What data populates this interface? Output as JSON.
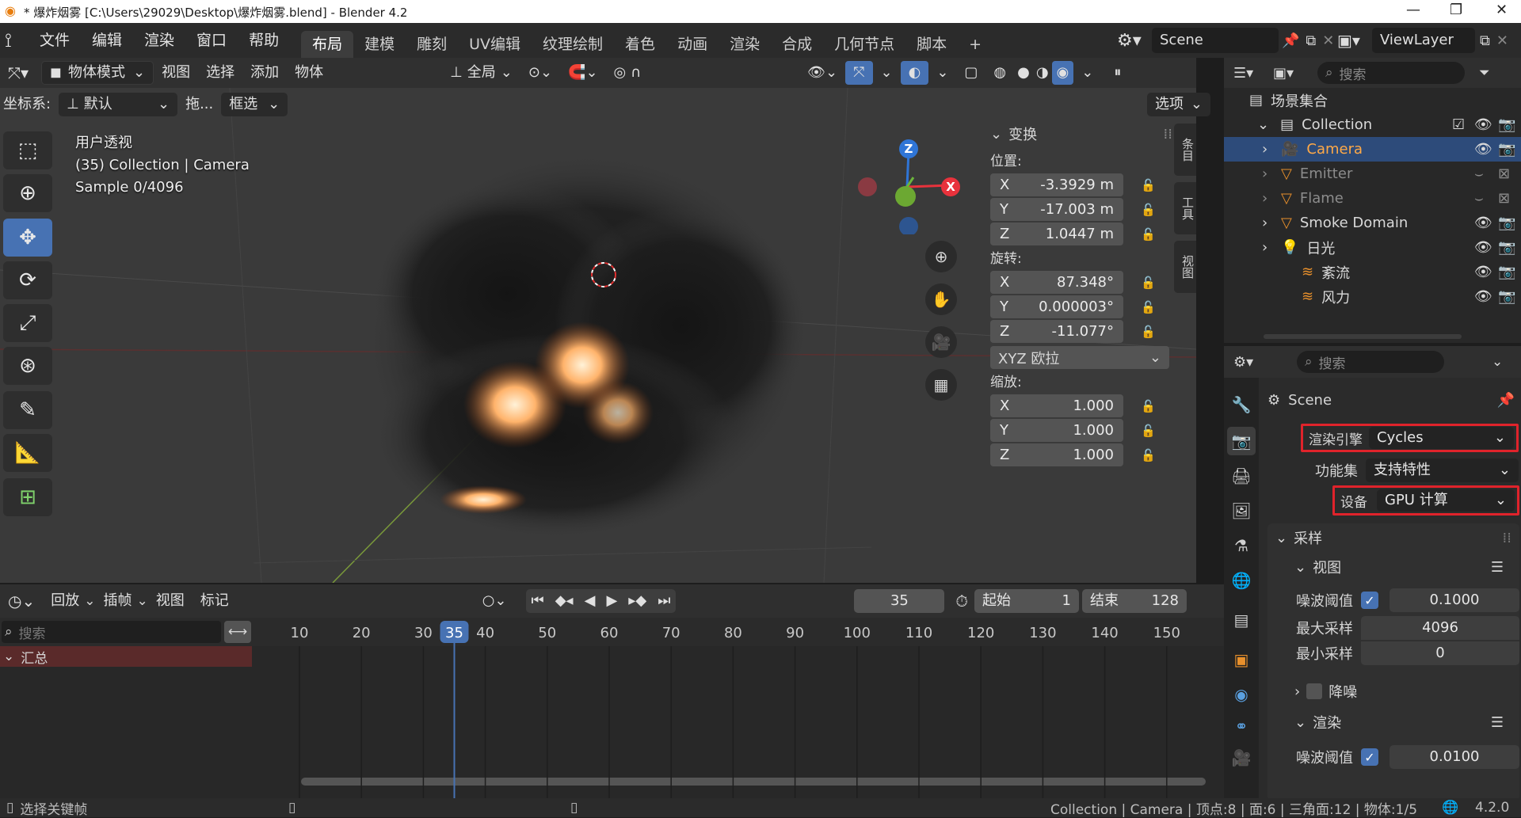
{
  "window": {
    "title": "* 爆炸烟雾 [C:\\Users\\29029\\Desktop\\爆炸烟雾.blend] - Blender 4.2",
    "controls": [
      "—",
      "❐",
      "✕"
    ]
  },
  "menu": [
    "文件",
    "编辑",
    "渲染",
    "窗口",
    "帮助"
  ],
  "workspaces": [
    "布局",
    "建模",
    "雕刻",
    "UV编辑",
    "纹理绘制",
    "着色",
    "动画",
    "渲染",
    "合成",
    "几何节点",
    "脚本",
    "+"
  ],
  "scene": {
    "name": "Scene"
  },
  "viewlayer": {
    "name": "ViewLayer"
  },
  "viewport_header": {
    "mode": "物体模式",
    "menus": [
      "视图",
      "选择",
      "添加",
      "物体"
    ],
    "transform_orientation": "全局"
  },
  "viewport_header2": {
    "coord_label": "坐标系:",
    "coord_value": "默认",
    "drag_label": "拖...",
    "select_mode": "框选",
    "options": "选项"
  },
  "viewport_overlay": {
    "view_name": "用户透视",
    "collection_line": "(35) Collection | Camera",
    "sample_line": "Sample 0/4096"
  },
  "gizmo": {
    "z": "Z",
    "x": "X"
  },
  "npanel": {
    "section": "变换",
    "location_label": "位置:",
    "location": [
      {
        "axis": "X",
        "value": "-3.3929 m"
      },
      {
        "axis": "Y",
        "value": "-17.003 m"
      },
      {
        "axis": "Z",
        "value": "1.0447 m"
      }
    ],
    "rotation_label": "旋转:",
    "rotation": [
      {
        "axis": "X",
        "value": "87.348°"
      },
      {
        "axis": "Y",
        "value": "0.000003°"
      },
      {
        "axis": "Z",
        "value": "-11.077°"
      }
    ],
    "rotation_mode": "XYZ 欧拉",
    "scale_label": "缩放:",
    "scale": [
      {
        "axis": "X",
        "value": "1.000"
      },
      {
        "axis": "Y",
        "value": "1.000"
      },
      {
        "axis": "Z",
        "value": "1.000"
      }
    ],
    "side_tabs": [
      "条目",
      "工具",
      "视图"
    ]
  },
  "outliner": {
    "search_placeholder": "搜索",
    "root": "场景集合",
    "collection": "Collection",
    "items": [
      {
        "name": "Camera",
        "selected": true
      },
      {
        "name": "Emitter",
        "dim": true
      },
      {
        "name": "Flame",
        "dim": true
      },
      {
        "name": "Smoke Domain"
      },
      {
        "name": "日光"
      },
      {
        "name": "紊流"
      },
      {
        "name": "风力"
      }
    ]
  },
  "properties": {
    "search_placeholder": "搜索",
    "scene": "Scene",
    "render_engine_label": "渲染引擎",
    "render_engine": "Cycles",
    "feature_set_label": "功能集",
    "feature_set": "支持特性",
    "device_label": "设备",
    "device": "GPU 计算",
    "sampling": "采样",
    "viewport": "视图",
    "noise_threshold_label": "噪波阈值",
    "noise_threshold_view": "0.1000",
    "max_samples_label": "最大采样",
    "max_samples": "4096",
    "min_samples_label": "最小采样",
    "min_samples": "0",
    "denoise": "降噪",
    "render": "渲染",
    "noise_threshold_render": "0.0100"
  },
  "timeline": {
    "menus": [
      "回放",
      "插帧",
      "视图",
      "标记"
    ],
    "current_frame": "35",
    "start_label": "起始",
    "start": "1",
    "end_label": "结束",
    "end": "128",
    "search_placeholder": "搜索",
    "summary": "汇总",
    "ticks": [
      "10",
      "20",
      "30",
      "35",
      "40",
      "50",
      "60",
      "70",
      "80",
      "90",
      "100",
      "110",
      "120",
      "130",
      "140",
      "150"
    ]
  },
  "statusbar": {
    "left": "选择关键帧",
    "right": "Collection | Camera | 顶点:8 | 面:6 | 三角面:12 | 物体:1/5",
    "version": "4.2.0"
  }
}
